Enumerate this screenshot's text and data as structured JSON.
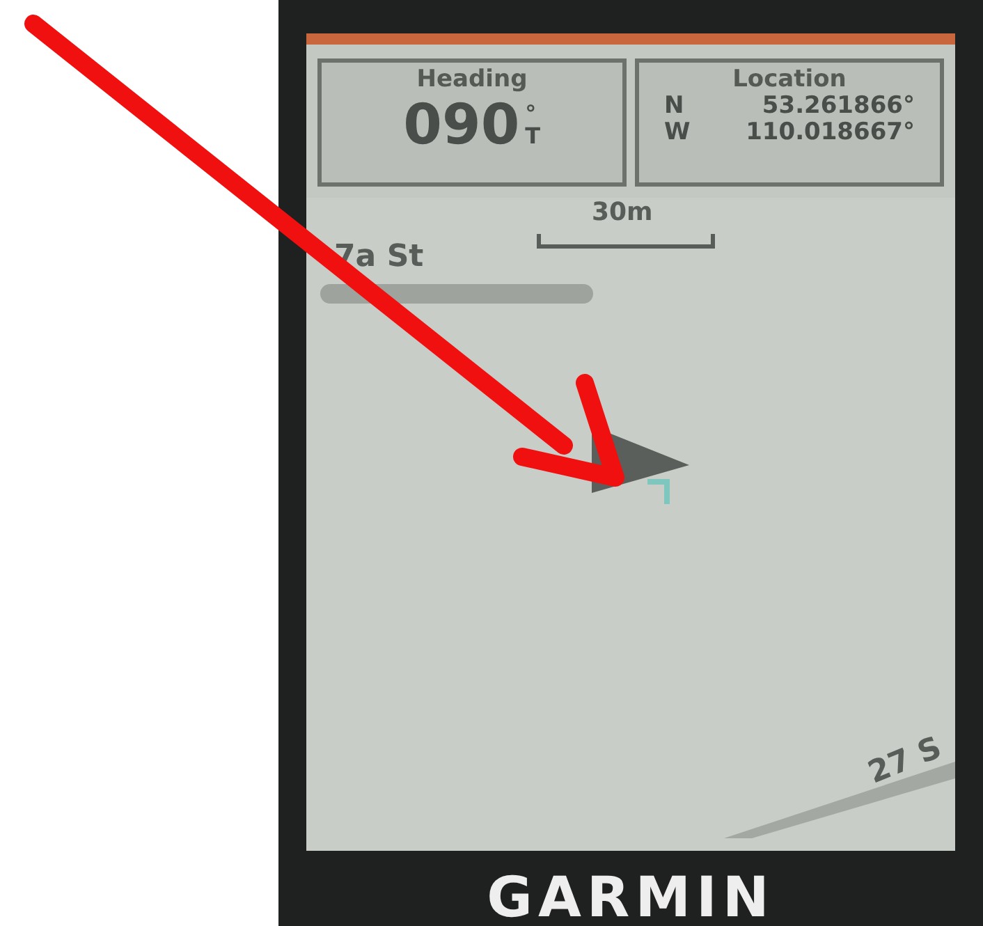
{
  "data_fields": [
    {
      "label": "Heading",
      "value": "090",
      "unit": "°T"
    },
    {
      "label": "Location",
      "lines": [
        {
          "hemisphere": "N",
          "value": "53.261866°"
        },
        {
          "hemisphere": "W",
          "value": "110.018667°"
        }
      ]
    }
  ],
  "map": {
    "scale": "30m",
    "streets": [
      {
        "kind": "horizontal",
        "name": "7a St"
      },
      {
        "kind": "diagonal",
        "name": "27 S"
      }
    ]
  },
  "device": {
    "brand": "GARMIN"
  }
}
